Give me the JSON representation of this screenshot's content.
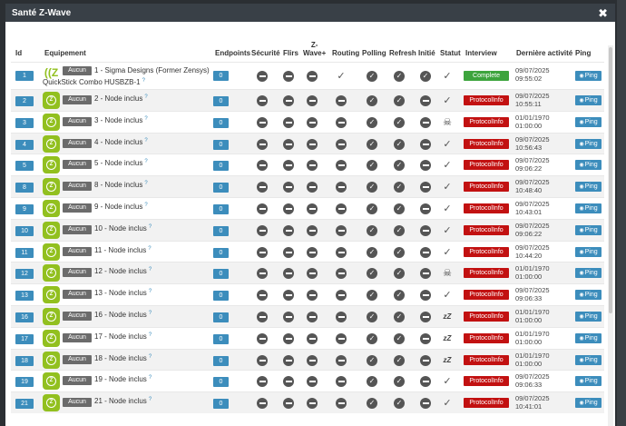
{
  "window": {
    "title": "Santé Z-Wave"
  },
  "columns": [
    "Id",
    "Equipement",
    "Endpoints",
    "Sécurité",
    "Flirs",
    "Z-\nWave+",
    "Routing",
    "Polling",
    "Refresh",
    "Initié",
    "Statut",
    "Interview",
    "Dernière activité",
    "Ping"
  ],
  "labels": {
    "aucun": "Aucun",
    "ping": "Ping"
  },
  "rows": [
    {
      "id": "1",
      "name": "1 - Sigma Designs (Former Zensys)",
      "name2": "QuickStick Combo HUSBZB-1",
      "endpoints": "0",
      "securite": "minus",
      "flirs": "minus",
      "zwplus": "minus",
      "routing": "tick",
      "polling": "ok",
      "refresh": "ok",
      "initie": "ok",
      "statut": "tick",
      "interview": "Complete",
      "last1": "09/07/2025",
      "last2": "09:55:02"
    },
    {
      "id": "2",
      "name": "2 - Node inclus",
      "endpoints": "0",
      "securite": "minus",
      "flirs": "minus",
      "zwplus": "minus",
      "routing": "minus",
      "polling": "ok",
      "refresh": "ok",
      "initie": "minus",
      "statut": "tick",
      "interview": "ProtocolInfo",
      "last1": "09/07/2025",
      "last2": "10:55:11"
    },
    {
      "id": "3",
      "name": "3 - Node inclus",
      "endpoints": "0",
      "securite": "minus",
      "flirs": "minus",
      "zwplus": "minus",
      "routing": "minus",
      "polling": "ok",
      "refresh": "ok",
      "initie": "minus",
      "statut": "skull",
      "interview": "ProtocolInfo",
      "last1": "01/01/1970",
      "last2": "01:00:00"
    },
    {
      "id": "4",
      "name": "4 - Node inclus",
      "endpoints": "0",
      "securite": "minus",
      "flirs": "minus",
      "zwplus": "minus",
      "routing": "minus",
      "polling": "ok",
      "refresh": "ok",
      "initie": "minus",
      "statut": "tick",
      "interview": "ProtocolInfo",
      "last1": "09/07/2025",
      "last2": "10:56:43"
    },
    {
      "id": "5",
      "name": "5 - Node inclus",
      "endpoints": "0",
      "securite": "minus",
      "flirs": "minus",
      "zwplus": "minus",
      "routing": "minus",
      "polling": "ok",
      "refresh": "ok",
      "initie": "minus",
      "statut": "tick",
      "interview": "ProtocolInfo",
      "last1": "09/07/2025",
      "last2": "09:06:22"
    },
    {
      "id": "8",
      "name": "8 - Node inclus",
      "endpoints": "0",
      "securite": "minus",
      "flirs": "minus",
      "zwplus": "minus",
      "routing": "minus",
      "polling": "ok",
      "refresh": "ok",
      "initie": "minus",
      "statut": "tick",
      "interview": "ProtocolInfo",
      "last1": "09/07/2025",
      "last2": "10:48:40"
    },
    {
      "id": "9",
      "name": "9 - Node inclus",
      "endpoints": "0",
      "securite": "minus",
      "flirs": "minus",
      "zwplus": "minus",
      "routing": "minus",
      "polling": "ok",
      "refresh": "ok",
      "initie": "minus",
      "statut": "tick",
      "interview": "ProtocolInfo",
      "last1": "09/07/2025",
      "last2": "10:43:01"
    },
    {
      "id": "10",
      "name": "10 - Node inclus",
      "endpoints": "0",
      "securite": "minus",
      "flirs": "minus",
      "zwplus": "minus",
      "routing": "minus",
      "polling": "ok",
      "refresh": "ok",
      "initie": "minus",
      "statut": "tick",
      "interview": "ProtocolInfo",
      "last1": "09/07/2025",
      "last2": "09:06:22"
    },
    {
      "id": "11",
      "name": "11 - Node inclus",
      "endpoints": "0",
      "securite": "minus",
      "flirs": "minus",
      "zwplus": "minus",
      "routing": "minus",
      "polling": "ok",
      "refresh": "ok",
      "initie": "minus",
      "statut": "tick",
      "interview": "ProtocolInfo",
      "last1": "09/07/2025",
      "last2": "10:44:20"
    },
    {
      "id": "12",
      "name": "12 - Node inclus",
      "endpoints": "0",
      "securite": "minus",
      "flirs": "minus",
      "zwplus": "minus",
      "routing": "minus",
      "polling": "ok",
      "refresh": "ok",
      "initie": "minus",
      "statut": "skull",
      "interview": "ProtocolInfo",
      "last1": "01/01/1970",
      "last2": "01:00:00"
    },
    {
      "id": "13",
      "name": "13 - Node inclus",
      "endpoints": "0",
      "securite": "minus",
      "flirs": "minus",
      "zwplus": "minus",
      "routing": "minus",
      "polling": "ok",
      "refresh": "ok",
      "initie": "minus",
      "statut": "tick",
      "interview": "ProtocolInfo",
      "last1": "09/07/2025",
      "last2": "09:06:33"
    },
    {
      "id": "16",
      "name": "16 - Node inclus",
      "endpoints": "0",
      "securite": "minus",
      "flirs": "minus",
      "zwplus": "minus",
      "routing": "minus",
      "polling": "ok",
      "refresh": "ok",
      "initie": "minus",
      "statut": "zzz",
      "interview": "ProtocolInfo",
      "last1": "01/01/1970",
      "last2": "01:00:00"
    },
    {
      "id": "17",
      "name": "17 - Node inclus",
      "endpoints": "0",
      "securite": "minus",
      "flirs": "minus",
      "zwplus": "minus",
      "routing": "minus",
      "polling": "ok",
      "refresh": "ok",
      "initie": "minus",
      "statut": "zzz",
      "interview": "ProtocolInfo",
      "last1": "01/01/1970",
      "last2": "01:00:00"
    },
    {
      "id": "18",
      "name": "18 - Node inclus",
      "endpoints": "0",
      "securite": "minus",
      "flirs": "minus",
      "zwplus": "minus",
      "routing": "minus",
      "polling": "ok",
      "refresh": "ok",
      "initie": "minus",
      "statut": "zzz",
      "interview": "ProtocolInfo",
      "last1": "01/01/1970",
      "last2": "01:00:00"
    },
    {
      "id": "19",
      "name": "19 - Node inclus",
      "endpoints": "0",
      "securite": "minus",
      "flirs": "minus",
      "zwplus": "minus",
      "routing": "minus",
      "polling": "ok",
      "refresh": "ok",
      "initie": "minus",
      "statut": "tick",
      "interview": "ProtocolInfo",
      "last1": "09/07/2025",
      "last2": "09:06:33"
    },
    {
      "id": "21",
      "name": "21 - Node inclus",
      "endpoints": "0",
      "securite": "minus",
      "flirs": "minus",
      "zwplus": "minus",
      "routing": "minus",
      "polling": "ok",
      "refresh": "ok",
      "initie": "minus",
      "statut": "tick",
      "interview": "ProtocolInfo",
      "last1": "09/07/2025",
      "last2": "10:41:01"
    }
  ]
}
